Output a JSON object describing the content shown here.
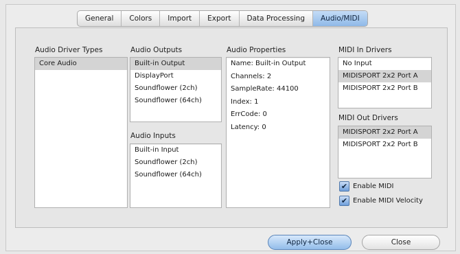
{
  "tabs": [
    {
      "label": "General",
      "active": false
    },
    {
      "label": "Colors",
      "active": false
    },
    {
      "label": "Import",
      "active": false
    },
    {
      "label": "Export",
      "active": false
    },
    {
      "label": "Data Processing",
      "active": false
    },
    {
      "label": "Audio/MIDI",
      "active": true
    }
  ],
  "driver_types": {
    "title": "Audio Driver Types",
    "items": [
      {
        "label": "Core Audio",
        "selected": true
      }
    ]
  },
  "outputs": {
    "title": "Audio Outputs",
    "items": [
      {
        "label": "Built-in Output",
        "selected": true
      },
      {
        "label": "DisplayPort",
        "selected": false
      },
      {
        "label": "Soundflower (2ch)",
        "selected": false
      },
      {
        "label": "Soundflower (64ch)",
        "selected": false
      }
    ]
  },
  "inputs": {
    "title": "Audio Inputs",
    "items": [
      {
        "label": "Built-in Input",
        "selected": false
      },
      {
        "label": "Soundflower (2ch)",
        "selected": false
      },
      {
        "label": "Soundflower (64ch)",
        "selected": false
      }
    ]
  },
  "properties": {
    "title": "Audio Properties",
    "lines": [
      "Name: Built-in Output",
      "Channels: 2",
      "SampleRate: 44100",
      "Index: 1",
      "ErrCode: 0",
      "Latency: 0"
    ]
  },
  "midi_in": {
    "title": "MIDI In Drivers",
    "items": [
      {
        "label": "No Input",
        "selected": false
      },
      {
        "label": "MIDISPORT 2x2 Port A",
        "selected": true
      },
      {
        "label": "MIDISPORT 2x2 Port B",
        "selected": false
      }
    ]
  },
  "midi_out": {
    "title": "MIDI Out Drivers",
    "items": [
      {
        "label": "MIDISPORT 2x2 Port A",
        "selected": true
      },
      {
        "label": "MIDISPORT 2x2 Port B",
        "selected": false
      }
    ]
  },
  "checkboxes": {
    "enable_midi": {
      "label": "Enable MIDI",
      "checked": true
    },
    "enable_midi_velocity": {
      "label": "Enable MIDI Velocity",
      "checked": true
    }
  },
  "buttons": {
    "apply_close": "Apply+Close",
    "close": "Close"
  },
  "colors": {
    "selection": "#d4d4d4",
    "accent_blue": "#8fb9e8"
  },
  "icons": {
    "checkmark": "✔"
  }
}
